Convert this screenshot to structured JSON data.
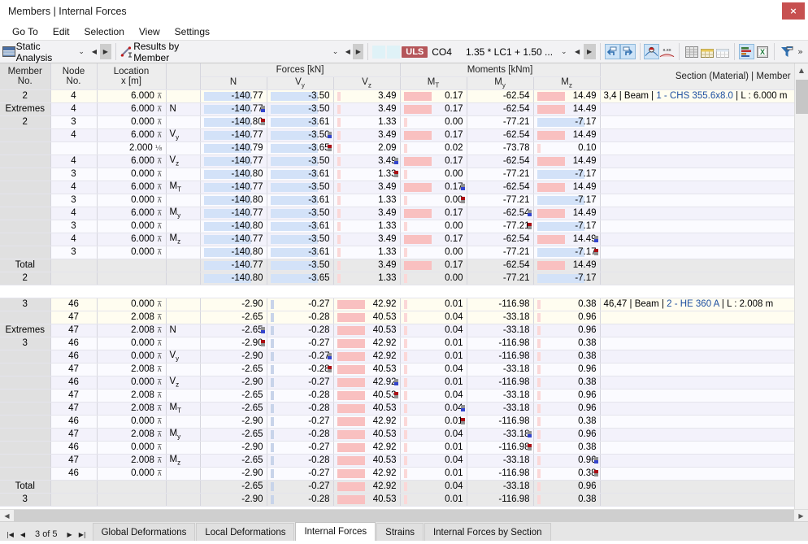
{
  "window": {
    "title": "Members | Internal Forces",
    "close_label": "×"
  },
  "menu": {
    "items": [
      "Go To",
      "Edit",
      "Selection",
      "View",
      "Settings"
    ]
  },
  "toolbar": {
    "analysis_combo": {
      "value": "Static Analysis",
      "icon": "static-analysis-icon"
    },
    "results_combo": {
      "value": "Results by Member",
      "icon": "results-by-member-icon"
    },
    "load_badge": "ULS",
    "load_case": "CO4",
    "load_combination": "1.35 * LC1 + 1.50 ...",
    "icons": [
      "undo-arrow-icon",
      "redo-arrow-icon",
      "result-diagram-icon",
      "result-values-icon",
      "table-grey-icon",
      "table-gold-icon",
      "table-light-icon",
      "chart-bars-icon",
      "excel-export-icon",
      "filter-icon",
      "overflow-icon"
    ]
  },
  "table": {
    "header": {
      "member_no": [
        "Member",
        "No."
      ],
      "node_no": [
        "Node",
        "No."
      ],
      "location": [
        "Location",
        "x [m]"
      ],
      "forces_group": "Forces [kN]",
      "moments_group": "Moments [kNm]",
      "cols": [
        "N",
        "V",
        "V",
        "M",
        "M",
        "M"
      ],
      "subs": [
        "",
        "y",
        "z",
        "T",
        "y",
        "z"
      ],
      "section_col": "Section (Material) | Member"
    },
    "blocks": [
      {
        "lead_top": "2",
        "lead_extremes": [
          "Extremes",
          "2"
        ],
        "lead_total": [
          "Total",
          "2"
        ],
        "section_text_prefix": "3,4 | Beam | ",
        "section_link": "1 - CHS 355.6x8.0",
        "section_text_suffix": " | L : 6.000 m",
        "rows": [
          {
            "style": "top",
            "node": "2_header",
            "node_no": "4",
            "loc": "6.000",
            "crit": "",
            "N": "-140.77",
            "Vy": "-3.50",
            "Vz": "3.49",
            "MT": "0.17",
            "My": "-62.54",
            "Mz": "14.49",
            "bars": {
              "N": "blue",
              "Vy": "blue",
              "Vz": "redl",
              "MT": "red",
              "Mz": "red"
            },
            "marks": {}
          },
          {
            "style": "even",
            "node_no": "4",
            "loc": "6.000",
            "crit": "N",
            "N": "-140.77",
            "Vy": "-3.50",
            "Vz": "3.49",
            "MT": "0.17",
            "My": "-62.54",
            "Mz": "14.49",
            "bars": {
              "N": "blue",
              "Vy": "blue",
              "Vz": "redl",
              "MT": "red",
              "Mz": "red"
            },
            "marks": {
              "N": "min"
            }
          },
          {
            "style": "odd",
            "node_no": "3",
            "loc": "0.000",
            "crit": "",
            "N": "-140.80",
            "Vy": "-3.61",
            "Vz": "1.33",
            "MT": "0.00",
            "My": "-77.21",
            "Mz": "-7.17",
            "bars": {
              "N": "blue",
              "Vy": "blue",
              "Vz": "redl",
              "MT": "redl",
              "Mz": "blue"
            },
            "marks": {
              "N": "max"
            }
          },
          {
            "style": "even",
            "node_no": "4",
            "loc": "6.000",
            "crit": "Vy",
            "N": "-140.77",
            "Vy": "-3.50",
            "Vz": "3.49",
            "MT": "0.17",
            "My": "-62.54",
            "Mz": "14.49",
            "bars": {
              "N": "blue",
              "Vy": "blue",
              "Vz": "redl",
              "MT": "red",
              "Mz": "red"
            },
            "marks": {
              "Vy": "min"
            }
          },
          {
            "style": "odd",
            "node_no": "",
            "loc": "2.000",
            "loc_frac": "⅛",
            "crit": "",
            "N": "-140.79",
            "Vy": "-3.65",
            "Vz": "2.09",
            "MT": "0.02",
            "My": "-73.78",
            "Mz": "0.10",
            "bars": {
              "N": "blue",
              "Vy": "blue",
              "Vz": "redl",
              "MT": "redl",
              "Mz": "redl"
            },
            "marks": {
              "Vy": "max"
            }
          },
          {
            "style": "even",
            "node_no": "4",
            "loc": "6.000",
            "crit": "Vz",
            "N": "-140.77",
            "Vy": "-3.50",
            "Vz": "3.49",
            "MT": "0.17",
            "My": "-62.54",
            "Mz": "14.49",
            "bars": {
              "N": "blue",
              "Vy": "blue",
              "Vz": "redl",
              "MT": "red",
              "Mz": "red"
            },
            "marks": {
              "Vz": "min"
            }
          },
          {
            "style": "odd",
            "node_no": "3",
            "loc": "0.000",
            "crit": "",
            "N": "-140.80",
            "Vy": "-3.61",
            "Vz": "1.33",
            "MT": "0.00",
            "My": "-77.21",
            "Mz": "-7.17",
            "bars": {
              "N": "blue",
              "Vy": "blue",
              "Vz": "redl",
              "MT": "redl",
              "Mz": "blue"
            },
            "marks": {
              "Vz": "max"
            }
          },
          {
            "style": "even",
            "node_no": "4",
            "loc": "6.000",
            "crit": "MT",
            "N": "-140.77",
            "Vy": "-3.50",
            "Vz": "3.49",
            "MT": "0.17",
            "My": "-62.54",
            "Mz": "14.49",
            "bars": {
              "N": "blue",
              "Vy": "blue",
              "Vz": "redl",
              "MT": "red",
              "Mz": "red"
            },
            "marks": {
              "MT": "min"
            }
          },
          {
            "style": "odd",
            "node_no": "3",
            "loc": "0.000",
            "crit": "",
            "N": "-140.80",
            "Vy": "-3.61",
            "Vz": "1.33",
            "MT": "0.00",
            "My": "-77.21",
            "Mz": "-7.17",
            "bars": {
              "N": "blue",
              "Vy": "blue",
              "Vz": "redl",
              "MT": "redl",
              "Mz": "blue"
            },
            "marks": {
              "MT": "max"
            }
          },
          {
            "style": "even",
            "node_no": "4",
            "loc": "6.000",
            "crit": "My",
            "N": "-140.77",
            "Vy": "-3.50",
            "Vz": "3.49",
            "MT": "0.17",
            "My": "-62.54",
            "Mz": "14.49",
            "bars": {
              "N": "blue",
              "Vy": "blue",
              "Vz": "redl",
              "MT": "red",
              "Mz": "red"
            },
            "marks": {
              "My": "min"
            }
          },
          {
            "style": "odd",
            "node_no": "3",
            "loc": "0.000",
            "crit": "",
            "N": "-140.80",
            "Vy": "-3.61",
            "Vz": "1.33",
            "MT": "0.00",
            "My": "-77.21",
            "Mz": "-7.17",
            "bars": {
              "N": "blue",
              "Vy": "blue",
              "Vz": "redl",
              "MT": "redl",
              "Mz": "blue"
            },
            "marks": {
              "My": "max"
            }
          },
          {
            "style": "even",
            "node_no": "4",
            "loc": "6.000",
            "crit": "Mz",
            "N": "-140.77",
            "Vy": "-3.50",
            "Vz": "3.49",
            "MT": "0.17",
            "My": "-62.54",
            "Mz": "14.49",
            "bars": {
              "N": "blue",
              "Vy": "blue",
              "Vz": "redl",
              "MT": "red",
              "Mz": "red"
            },
            "marks": {
              "Mz": "min"
            }
          },
          {
            "style": "odd",
            "node_no": "3",
            "loc": "0.000",
            "crit": "",
            "N": "-140.80",
            "Vy": "-3.61",
            "Vz": "1.33",
            "MT": "0.00",
            "My": "-77.21",
            "Mz": "-7.17",
            "bars": {
              "N": "blue",
              "Vy": "blue",
              "Vz": "redl",
              "MT": "redl",
              "Mz": "blue"
            },
            "marks": {
              "Mz": "max"
            }
          },
          {
            "style": "total",
            "node_no": "",
            "loc": "",
            "crit": "",
            "N": "-140.77",
            "Vy": "-3.50",
            "Vz": "3.49",
            "MT": "0.17",
            "My": "-62.54",
            "Mz": "14.49",
            "bars": {
              "N": "blue",
              "Vy": "blue",
              "Vz": "redl",
              "MT": "red",
              "Mz": "red"
            },
            "marks": {}
          },
          {
            "style": "total",
            "node_no": "",
            "loc": "",
            "crit": "",
            "N": "-140.80",
            "Vy": "-3.65",
            "Vz": "1.33",
            "MT": "0.00",
            "My": "-77.21",
            "Mz": "-7.17",
            "bars": {
              "N": "blue",
              "Vy": "blue",
              "Vz": "redl",
              "MT": "redl",
              "Mz": "blue"
            },
            "marks": {}
          }
        ]
      },
      {
        "lead_top": "3",
        "lead_extremes": [
          "Extremes",
          "3"
        ],
        "lead_total": [
          "Total",
          "3"
        ],
        "section_text_prefix": "46,47 | Beam | ",
        "section_link": "2 - HE 360 A",
        "section_text_suffix": " | L : 2.008 m",
        "rows": [
          {
            "style": "top",
            "node_no": "46",
            "loc": "0.000",
            "crit": "",
            "N": "-2.90",
            "Vy": "-0.27",
            "Vz": "42.92",
            "MT": "0.01",
            "My": "-116.98",
            "Mz": "0.38",
            "bars": {
              "Vy": "bluel",
              "Vz": "red",
              "MT": "redl",
              "Mz": "redl"
            },
            "marks": {}
          },
          {
            "style": "top",
            "node_no": "47",
            "loc": "2.008",
            "crit": "",
            "N": "-2.65",
            "Vy": "-0.28",
            "Vz": "40.53",
            "MT": "0.04",
            "My": "-33.18",
            "Mz": "0.96",
            "bars": {
              "Vy": "bluel",
              "Vz": "red",
              "MT": "redl",
              "Mz": "redl"
            },
            "marks": {}
          },
          {
            "style": "even",
            "node_no": "47",
            "loc": "2.008",
            "crit": "N",
            "N": "-2.65",
            "Vy": "-0.28",
            "Vz": "40.53",
            "MT": "0.04",
            "My": "-33.18",
            "Mz": "0.96",
            "bars": {
              "Vy": "bluel",
              "Vz": "red",
              "MT": "redl",
              "Mz": "redl"
            },
            "marks": {
              "N": "min"
            }
          },
          {
            "style": "odd",
            "node_no": "46",
            "loc": "0.000",
            "crit": "",
            "N": "-2.90",
            "Vy": "-0.27",
            "Vz": "42.92",
            "MT": "0.01",
            "My": "-116.98",
            "Mz": "0.38",
            "bars": {
              "Vy": "bluel",
              "Vz": "red",
              "MT": "redl",
              "Mz": "redl"
            },
            "marks": {
              "N": "max"
            }
          },
          {
            "style": "even",
            "node_no": "46",
            "loc": "0.000",
            "crit": "Vy",
            "N": "-2.90",
            "Vy": "-0.27",
            "Vz": "42.92",
            "MT": "0.01",
            "My": "-116.98",
            "Mz": "0.38",
            "bars": {
              "Vy": "bluel",
              "Vz": "red",
              "MT": "redl",
              "Mz": "redl"
            },
            "marks": {
              "Vy": "min"
            }
          },
          {
            "style": "odd",
            "node_no": "47",
            "loc": "2.008",
            "crit": "",
            "N": "-2.65",
            "Vy": "-0.28",
            "Vz": "40.53",
            "MT": "0.04",
            "My": "-33.18",
            "Mz": "0.96",
            "bars": {
              "Vy": "bluel",
              "Vz": "red",
              "MT": "redl",
              "Mz": "redl"
            },
            "marks": {
              "Vy": "max"
            }
          },
          {
            "style": "even",
            "node_no": "46",
            "loc": "0.000",
            "crit": "Vz",
            "N": "-2.90",
            "Vy": "-0.27",
            "Vz": "42.92",
            "MT": "0.01",
            "My": "-116.98",
            "Mz": "0.38",
            "bars": {
              "Vy": "bluel",
              "Vz": "red",
              "MT": "redl",
              "Mz": "redl"
            },
            "marks": {
              "Vz": "min"
            }
          },
          {
            "style": "odd",
            "node_no": "47",
            "loc": "2.008",
            "crit": "",
            "N": "-2.65",
            "Vy": "-0.28",
            "Vz": "40.53",
            "MT": "0.04",
            "My": "-33.18",
            "Mz": "0.96",
            "bars": {
              "Vy": "bluel",
              "Vz": "red",
              "MT": "redl",
              "Mz": "redl"
            },
            "marks": {
              "Vz": "max"
            }
          },
          {
            "style": "even",
            "node_no": "47",
            "loc": "2.008",
            "crit": "MT",
            "N": "-2.65",
            "Vy": "-0.28",
            "Vz": "40.53",
            "MT": "0.04",
            "My": "-33.18",
            "Mz": "0.96",
            "bars": {
              "Vy": "bluel",
              "Vz": "red",
              "MT": "redl",
              "Mz": "redl"
            },
            "marks": {
              "MT": "min"
            }
          },
          {
            "style": "odd",
            "node_no": "46",
            "loc": "0.000",
            "crit": "",
            "N": "-2.90",
            "Vy": "-0.27",
            "Vz": "42.92",
            "MT": "0.01",
            "My": "-116.98",
            "Mz": "0.38",
            "bars": {
              "Vy": "bluel",
              "Vz": "red",
              "MT": "redl",
              "Mz": "redl"
            },
            "marks": {
              "MT": "max"
            }
          },
          {
            "style": "even",
            "node_no": "47",
            "loc": "2.008",
            "crit": "My",
            "N": "-2.65",
            "Vy": "-0.28",
            "Vz": "40.53",
            "MT": "0.04",
            "My": "-33.18",
            "Mz": "0.96",
            "bars": {
              "Vy": "bluel",
              "Vz": "red",
              "MT": "redl",
              "Mz": "redl"
            },
            "marks": {
              "My": "min"
            }
          },
          {
            "style": "odd",
            "node_no": "46",
            "loc": "0.000",
            "crit": "",
            "N": "-2.90",
            "Vy": "-0.27",
            "Vz": "42.92",
            "MT": "0.01",
            "My": "-116.98",
            "Mz": "0.38",
            "bars": {
              "Vy": "bluel",
              "Vz": "red",
              "MT": "redl",
              "Mz": "redl"
            },
            "marks": {
              "My": "max"
            }
          },
          {
            "style": "even",
            "node_no": "47",
            "loc": "2.008",
            "crit": "Mz",
            "N": "-2.65",
            "Vy": "-0.28",
            "Vz": "40.53",
            "MT": "0.04",
            "My": "-33.18",
            "Mz": "0.96",
            "bars": {
              "Vy": "bluel",
              "Vz": "red",
              "MT": "redl",
              "Mz": "redl"
            },
            "marks": {
              "Mz": "min"
            }
          },
          {
            "style": "odd",
            "node_no": "46",
            "loc": "0.000",
            "crit": "",
            "N": "-2.90",
            "Vy": "-0.27",
            "Vz": "42.92",
            "MT": "0.01",
            "My": "-116.98",
            "Mz": "0.38",
            "bars": {
              "Vy": "bluel",
              "Vz": "red",
              "MT": "redl",
              "Mz": "redl"
            },
            "marks": {
              "Mz": "max"
            }
          },
          {
            "style": "total",
            "node_no": "",
            "loc": "",
            "crit": "",
            "N": "-2.65",
            "Vy": "-0.27",
            "Vz": "42.92",
            "MT": "0.04",
            "My": "-33.18",
            "Mz": "0.96",
            "bars": {
              "Vy": "bluel",
              "Vz": "red",
              "MT": "redl",
              "Mz": "redl"
            },
            "marks": {}
          },
          {
            "style": "total",
            "node_no": "",
            "loc": "",
            "crit": "",
            "N": "-2.90",
            "Vy": "-0.28",
            "Vz": "40.53",
            "MT": "0.01",
            "My": "-116.98",
            "Mz": "0.38",
            "bars": {
              "Vy": "bluel",
              "Vz": "red",
              "MT": "redl",
              "Mz": "redl"
            },
            "marks": {}
          }
        ]
      }
    ]
  },
  "statusbar": {
    "page_label": "3 of 5",
    "tabs": [
      {
        "label": "Global Deformations",
        "active": false
      },
      {
        "label": "Local Deformations",
        "active": false
      },
      {
        "label": "Internal Forces",
        "active": true
      },
      {
        "label": "Strains",
        "active": false
      },
      {
        "label": "Internal Forces by Section",
        "active": false
      }
    ]
  },
  "colors": {
    "accent_red": "#b5565a",
    "bar_blue": "#d3e2f8",
    "bar_red": "#f9c0c0",
    "link": "#1d4fa0"
  }
}
